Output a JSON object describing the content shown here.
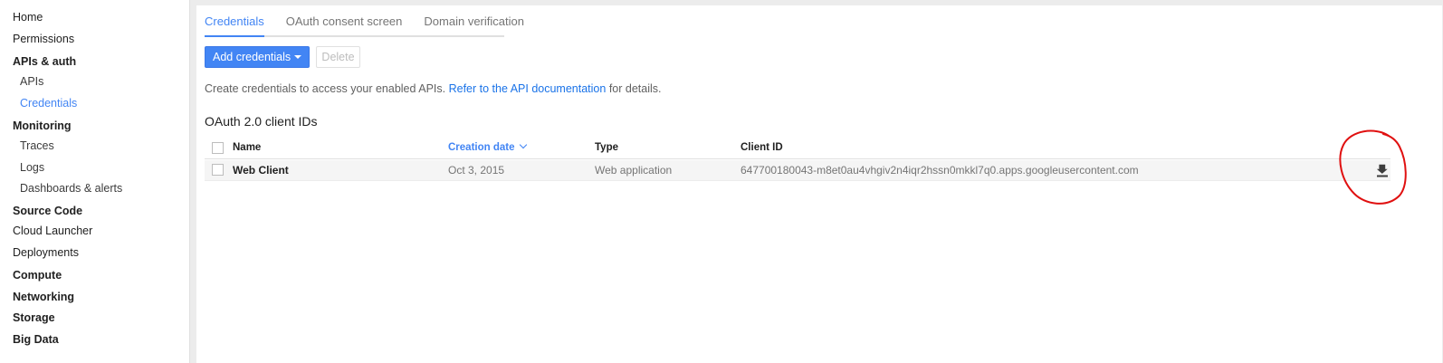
{
  "sidebar": {
    "items": [
      {
        "label": "Home"
      },
      {
        "label": "Permissions"
      },
      {
        "label": "APIs & auth"
      },
      {
        "label": "APIs"
      },
      {
        "label": "Credentials"
      },
      {
        "label": "Monitoring"
      },
      {
        "label": "Traces"
      },
      {
        "label": "Logs"
      },
      {
        "label": "Dashboards & alerts"
      },
      {
        "label": "Source Code"
      },
      {
        "label": "Cloud Launcher"
      },
      {
        "label": "Deployments"
      },
      {
        "label": "Compute"
      },
      {
        "label": "Networking"
      },
      {
        "label": "Storage"
      },
      {
        "label": "Big Data"
      }
    ]
  },
  "tabs": [
    {
      "label": "Credentials",
      "active": true
    },
    {
      "label": "OAuth consent screen"
    },
    {
      "label": "Domain verification"
    }
  ],
  "toolbar": {
    "add_label": "Add credentials",
    "delete_label": "Delete"
  },
  "intro": {
    "text_before": "Create credentials to access your enabled APIs.",
    "link": "Refer to the API documentation",
    "text_after": "for details."
  },
  "section_title": "OAuth 2.0 client IDs",
  "table": {
    "columns": [
      "Name",
      "Creation date",
      "Type",
      "Client ID"
    ],
    "rows": [
      {
        "name": "Web Client",
        "created": "Oct 3, 2015",
        "type": "Web application",
        "client_id": "647700180043-m8et0au4vhgiv2n4iqr2hssn0mkkl7q0.apps.googleusercontent.com"
      }
    ]
  },
  "colors": {
    "accent": "#4285f4",
    "annotation": "#e01010"
  },
  "icons": {
    "download": "download-icon",
    "sort": "chevron-down-icon"
  }
}
